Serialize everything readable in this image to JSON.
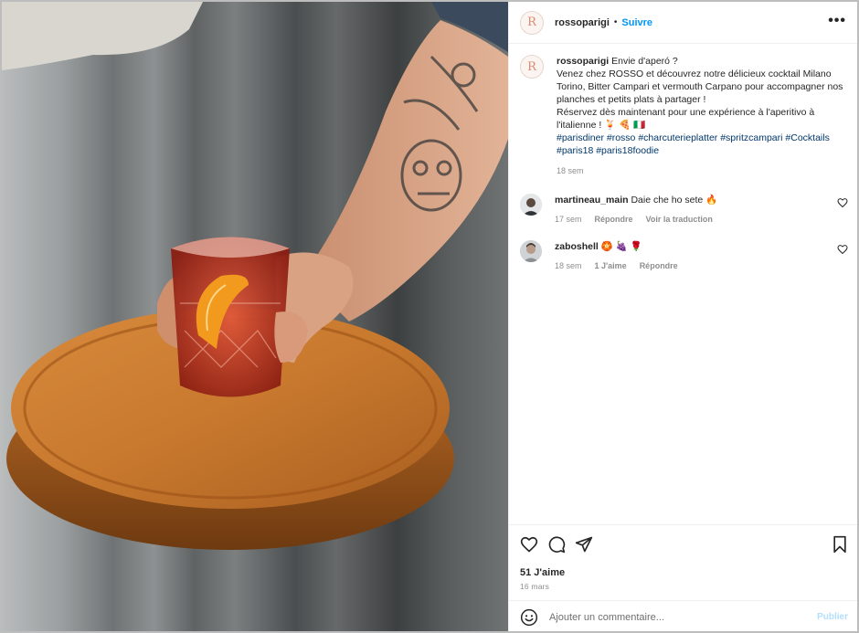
{
  "post": {
    "username": "rossoparigi",
    "separator": "•",
    "follow_label": "Suivre",
    "more_label": "•••",
    "avatar_letter": "R"
  },
  "caption": {
    "username": "rossoparigi",
    "lines": [
      "Envie d'aperó ?",
      "Venez chez ROSSO et découvrez notre délicieux cocktail Milano Torino, Bitter Campari et vermouth Carpano pour accompagner nos planches et petits plats à partager !",
      "Réservez dès maintenant pour une expérience à l'aperitivo à l'italienne ! 🍹 🍕 🇮🇹"
    ],
    "hashtags": [
      "#parisdiner",
      "#rosso",
      "#charcuterieplatter",
      "#spritzcampari",
      "#Cocktails",
      "#paris18",
      "#paris18foodie"
    ],
    "time": "18 sem"
  },
  "comments": [
    {
      "username": "martineau_main",
      "text": "Daie che ho sete 🔥",
      "time": "17 sem",
      "likes": "",
      "reply_label": "Répondre",
      "translate_label": "Voir la traduction"
    },
    {
      "username": "zaboshell",
      "text": "🏵️ 🍇 🌹",
      "time": "18 sem",
      "likes": "1 J'aime",
      "reply_label": "Répondre",
      "translate_label": ""
    }
  ],
  "footer": {
    "likes": "51 J'aime",
    "date": "16 mars",
    "comment_placeholder": "Ajouter un commentaire...",
    "publish_label": "Publier"
  },
  "colors": {
    "link_blue": "#0095f6",
    "hashtag": "#00376b",
    "muted": "#8e8e8e",
    "publish_disabled": "#b2dffc",
    "leather": "#c8792e"
  },
  "icons": [
    "heart-icon",
    "comment-icon",
    "share-icon",
    "bookmark-icon",
    "emoji-icon",
    "more-icon"
  ]
}
